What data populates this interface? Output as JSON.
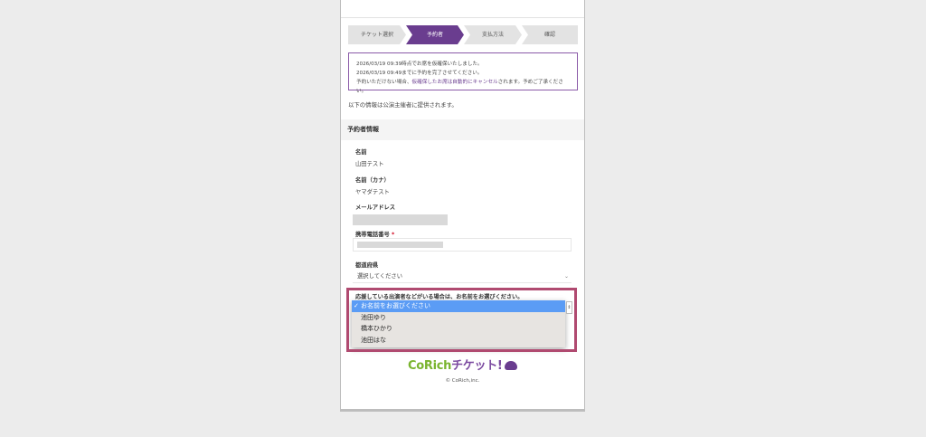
{
  "steps": [
    {
      "label": "チケット選択",
      "active": false
    },
    {
      "label": "予約者",
      "active": true
    },
    {
      "label": "支払方法",
      "active": false
    },
    {
      "label": "確認",
      "active": false
    }
  ],
  "notice": {
    "line1": "2026/03/19 09:39時点でお席を仮確保いたしました。",
    "line2": "2026/03/19 09:49までに予約を完了させてください。",
    "line3_pre": "予約いただけない場合、",
    "line3_link": "仮確保したお席は自動的にキャンセル",
    "line3_post": "されます。予めご了承ください。"
  },
  "info_text": "以下の情報は公演主催者に提供されます。",
  "section_title": "予約者情報",
  "fields": {
    "name_label": "名前",
    "name_value": "山田テスト",
    "kana_label": "名前（カナ）",
    "kana_value": "ヤマダテスト",
    "email_label": "メールアドレス",
    "phone_label": "携帯電話番号",
    "required_mark": "*",
    "prefecture_label": "都道府県",
    "prefecture_value": "選択してください"
  },
  "performer": {
    "label": "応援している出演者などがいる場合は、お名前をお選びください。",
    "options": [
      "お名前をお選びください",
      "池田ゆり",
      "橋本ひかり",
      "池田はな"
    ],
    "selected_index": 0
  },
  "footer": {
    "logo_a": "CoRich",
    "logo_b": "チケット!",
    "copyright": "© CoRich,inc."
  },
  "colors": {
    "brand_purple": "#6a3d8f",
    "logo_green": "#7ab42f",
    "highlight_border": "#b04a70",
    "select_blue": "#5b9cf5"
  }
}
